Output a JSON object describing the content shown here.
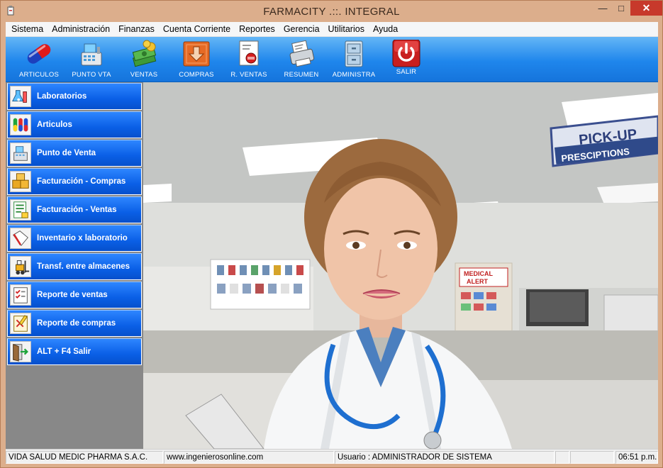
{
  "window": {
    "title": "FARMACITY .::.  INTEGRAL"
  },
  "menu": [
    "Sistema",
    "Administración",
    "Finanzas",
    "Cuenta Corriente",
    "Reportes",
    "Gerencia",
    "Utilitarios",
    "Ayuda"
  ],
  "toolbar": [
    {
      "label": "ARTICULOS",
      "icon": "capsule-icon"
    },
    {
      "label": "PUNTO VTA",
      "icon": "cash-register-icon"
    },
    {
      "label": "VENTAS",
      "icon": "money-stack-icon"
    },
    {
      "label": "COMPRAS",
      "icon": "download-box-icon"
    },
    {
      "label": "R. VENTAS",
      "icon": "sales-report-icon"
    },
    {
      "label": "RESUMEN",
      "icon": "summary-printer-icon"
    },
    {
      "label": "ADMINISTRA",
      "icon": "file-cabinet-icon"
    },
    {
      "label": "SALIR",
      "icon": "power-icon"
    }
  ],
  "sidebar": [
    {
      "label": "Laboratorios",
      "icon": "lab-flask-icon"
    },
    {
      "label": "Articulos",
      "icon": "pills-icon"
    },
    {
      "label": "Punto de Venta",
      "icon": "cash-register-icon"
    },
    {
      "label": "Facturación - Compras",
      "icon": "boxes-icon"
    },
    {
      "label": "Facturación - Ventas",
      "icon": "invoice-icon"
    },
    {
      "label": "Inventario x laboratorio",
      "icon": "inventory-book-icon"
    },
    {
      "label": "Transf. entre almacenes",
      "icon": "forklift-icon"
    },
    {
      "label": "Reporte de ventas",
      "icon": "checklist-icon"
    },
    {
      "label": "Reporte de compras",
      "icon": "report-edit-icon"
    },
    {
      "label": "ALT + F4  Salir",
      "icon": "exit-door-icon"
    }
  ],
  "photo": {
    "sign_line1": "PICK-UP",
    "sign_line2": "PRESCIPTIONS",
    "alert_line1": "MEDICAL",
    "alert_line2": "ALERT"
  },
  "status": {
    "company": "VIDA SALUD MEDIC PHARMA S.A.C.",
    "website": "www.ingenierosonline.com",
    "user": "Usuario : ADMINISTRADOR DE SISTEMA",
    "time": "06:51 p.m."
  },
  "colors": {
    "toolbar": "#1f86ec",
    "sidebar_button": "#0a5fe6",
    "close": "#c7392b"
  }
}
